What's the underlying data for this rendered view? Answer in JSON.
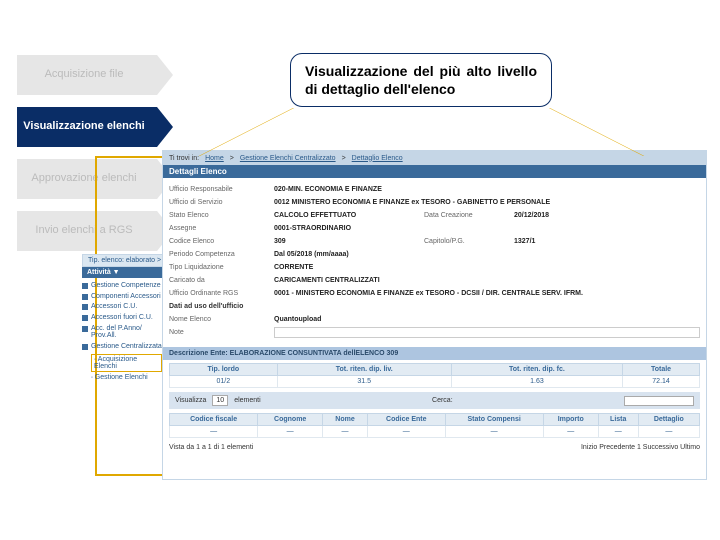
{
  "steps": [
    {
      "label": "Acquisizione file",
      "active": false
    },
    {
      "label": "Visualizzazione elenchi",
      "active": true
    },
    {
      "label": "Approvazione elenchi",
      "active": false
    },
    {
      "label": "Invio elenchi a RGS",
      "active": false
    }
  ],
  "callout": "Visualizzazione del più alto livello di dettaglio dell'elenco",
  "breadcrumb": {
    "full": "Ti trovi in:",
    "home": "Home",
    "p1": "Gestione Elenchi Centralizzato",
    "p2": "Dettaglio Elenco"
  },
  "section_title": "Dettagli Elenco",
  "fields": {
    "uff_resp_l": "Ufficio Responsabile",
    "uff_resp_v": "020-MIN. ECONOMIA E FINANZE",
    "uff_serv_l": "Ufficio di Servizio",
    "uff_serv_v": "0012 MINISTERO ECONOMIA E FINANZE ex TESORO - GABINETTO E PERSONALE",
    "stato_l": "Stato Elenco",
    "stato_v": "CALCOLO EFFETTUATO",
    "data_c_l": "Data Creazione",
    "data_c_v": "20/12/2018",
    "assegne_l": "Assegne",
    "assegne_v": "0001-STRAORDINARIO",
    "cod_l": "Codice Elenco",
    "cod_v": "309",
    "cap_l": "Capitolo/P.G.",
    "cap_v": "1327/1",
    "per_l": "Periodo Competenza",
    "per_v": "Dal 05/2018 (mm/aaaa)",
    "tipo_l": "Tipo Liquidazione",
    "tipo_v": "CORRENTE",
    "car_l": "Caricato da",
    "car_v": "CARICAMENTI CENTRALIZZATI",
    "uff_ord_l": "Ufficio Ordinante RGS",
    "uff_ord_v": "0001 - MINISTERO ECONOMIA E FINANZE ex TESORO - DCSII / DIR. CENTRALE SERV. IFRM.",
    "dati_uso": "Dati ad uso dell'ufficio",
    "nome_l": "Nome Elenco",
    "nome_v": "Quantoupload",
    "note_l": "Note"
  },
  "desc_label": "Descrizione Ente: ELABORAZIONE CONSUNTIVATA dellELENCO 309",
  "table1": {
    "headers": [
      "Tip. lordo",
      "Tot. riten. dip. liv.",
      "Tot. riten. dip. fc.",
      "Totale"
    ],
    "row": [
      "01/2",
      "31.5",
      "1.63",
      "72.14"
    ]
  },
  "pager": {
    "label": "Visualizza",
    "count": "10",
    "elem": "elementi",
    "search_l": "Cerca:"
  },
  "table2": {
    "headers": [
      "Codice fiscale",
      "Cognome",
      "Nome",
      "Codice Ente",
      "Stato Compensi",
      "Importo",
      "Lista",
      "Dettaglio"
    ]
  },
  "footer": {
    "left": "Vista da 1 a 1 di 1 elementi",
    "right": "Inizio  Precedente  1  Successivo  Ultimo"
  },
  "tabstrip": "Tip. elenco: elaborato > El",
  "side": {
    "tab": "Attività ▼",
    "l1": "Gestione Competenze",
    "l2": "Componenti Accessori",
    "l3": "Accessori C.U.",
    "l4": "Accessori fuori C.U.",
    "l5": "Acc. del P.Anno/ Prov.All.",
    "l6": "Gestione Centralizzata",
    "l7": "Acquisizione Elenchi",
    "l8": "Gestione Elenchi"
  }
}
